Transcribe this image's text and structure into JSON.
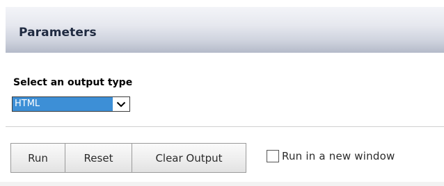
{
  "panel": {
    "title": "Parameters"
  },
  "output_type": {
    "label": "Select an output type",
    "selected": "HTML"
  },
  "buttons": {
    "run": "Run",
    "reset": "Reset",
    "clear_output": "Clear Output"
  },
  "new_window": {
    "label": "Run in a new window",
    "checked": false
  },
  "colors": {
    "select_highlight": "#3d8fd6",
    "header_text": "#1f2a40"
  }
}
